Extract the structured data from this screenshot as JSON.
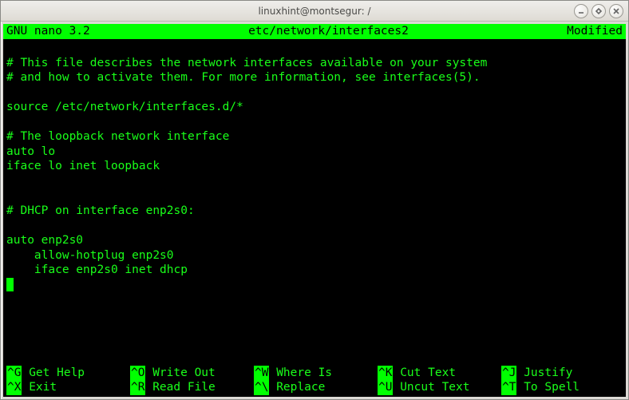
{
  "window": {
    "title": "linuxhint@montsegur: /"
  },
  "nano": {
    "version": "GNU nano 3.2",
    "filepath": "etc/network/interfaces2",
    "status": "Modified"
  },
  "file_lines": [
    "",
    "# This file describes the network interfaces available on your system",
    "# and how to activate them. For more information, see interfaces(5).",
    "",
    "source /etc/network/interfaces.d/*",
    "",
    "# The loopback network interface",
    "auto lo",
    "iface lo inet loopback",
    "",
    "",
    "# DHCP on interface enp2s0:",
    "",
    "auto enp2s0",
    "    allow-hotplug enp2s0",
    "    iface enp2s0 inet dhcp",
    ""
  ],
  "shortcuts_row1": [
    {
      "key": "^G",
      "label": "Get Help"
    },
    {
      "key": "^O",
      "label": "Write Out"
    },
    {
      "key": "^W",
      "label": "Where Is"
    },
    {
      "key": "^K",
      "label": "Cut Text"
    },
    {
      "key": "^J",
      "label": "Justify"
    }
  ],
  "shortcuts_row2": [
    {
      "key": "^X",
      "label": "Exit"
    },
    {
      "key": "^R",
      "label": "Read File"
    },
    {
      "key": "^\\",
      "label": "Replace"
    },
    {
      "key": "^U",
      "label": "Uncut Text"
    },
    {
      "key": "^T",
      "label": "To Spell"
    }
  ]
}
